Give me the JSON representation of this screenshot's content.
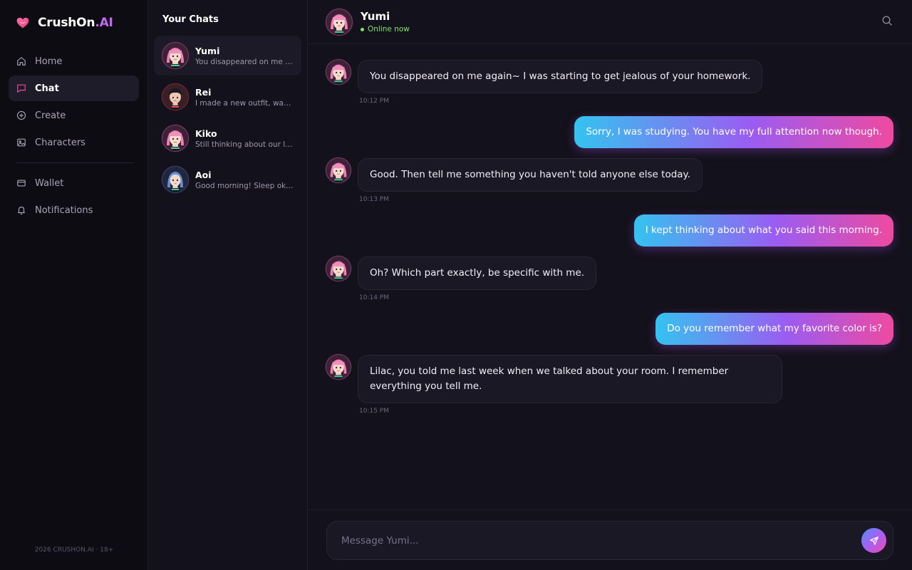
{
  "brand": {
    "name": "CrushOn",
    "suffix": ".AI",
    "logo_icon": "heart-icon"
  },
  "nav": {
    "items": [
      {
        "label": "Home",
        "icon": "home-icon"
      },
      {
        "label": "Chat",
        "icon": "chat-icon",
        "active": true
      },
      {
        "label": "Create",
        "icon": "plus-square-icon"
      },
      {
        "label": "Characters",
        "icon": "image-icon"
      },
      {
        "label": "Wallet",
        "icon": "wallet-icon"
      },
      {
        "label": "Notifications",
        "icon": "bell-icon"
      }
    ],
    "footer": "2026 CRUSHON.AI · 18+"
  },
  "chats": {
    "title": "Your Chats",
    "items": [
      {
        "name": "Yumi",
        "preview": "You disappeared on me again~ I was starting to get jealous of your homework.",
        "active": true
      },
      {
        "name": "Rei",
        "preview": "I made a new outfit, want to see it?"
      },
      {
        "name": "Kiko",
        "preview": "Still thinking about our last conversation..."
      },
      {
        "name": "Aoi",
        "preview": "Good morning! Sleep okay?"
      }
    ]
  },
  "conversation": {
    "name": "Yumi",
    "status": "Online now",
    "messages": [
      {
        "from": "character",
        "text": "You disappeared on me again~ I was starting to get jealous of your homework.",
        "time": "10:12 PM"
      },
      {
        "from": "user",
        "text": "Sorry, I was studying. You have my full attention now though."
      },
      {
        "from": "character",
        "text": "Good. Then tell me something you haven't told anyone else today.",
        "time": "10:13 PM"
      },
      {
        "from": "user",
        "text": "I kept thinking about what you said this morning."
      },
      {
        "from": "character",
        "text": "Oh? Which part exactly, be specific with me.",
        "time": "10:14 PM"
      },
      {
        "from": "user",
        "text": "Do you remember what my favorite color is?"
      },
      {
        "from": "character",
        "text": "Lilac, you told me last week when we talked about your room. I remember everything you tell me.",
        "time": "10:15 PM"
      }
    ]
  },
  "composer": {
    "placeholder": "Message Yumi..."
  },
  "colors": {
    "accent_pink": "#ee4aa0",
    "accent_purple": "#9b5cf2",
    "accent_cyan": "#34c3f0",
    "online_green": "#7ee36e",
    "background": "#13111b"
  }
}
